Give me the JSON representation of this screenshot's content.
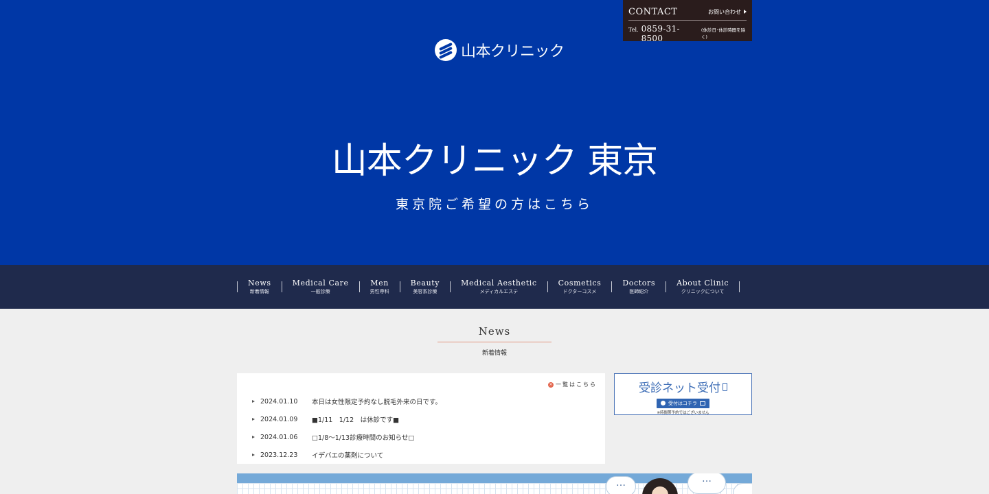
{
  "contact": {
    "title": "CONTACT",
    "inquiry_label": "お問い合わせ",
    "tel_label": "Tel.",
    "tel_number": "0859-31-8500",
    "tel_note": "(休診日･休診時間を除く)"
  },
  "logo": {
    "name": "山本クリニック"
  },
  "hero": {
    "title": "山本クリニック 東京",
    "subtitle": "東京院ご希望の方はこちら"
  },
  "nav": {
    "items": [
      {
        "en": "News",
        "jp": "新着情報"
      },
      {
        "en": "Medical Care",
        "jp": "一般診療"
      },
      {
        "en": "Men",
        "jp": "男性専科"
      },
      {
        "en": "Beauty",
        "jp": "美容系診療"
      },
      {
        "en": "Medical Aesthetic",
        "jp": "メディカルエステ"
      },
      {
        "en": "Cosmetics",
        "jp": "ドクターコスメ"
      },
      {
        "en": "Doctors",
        "jp": "医師紹介"
      },
      {
        "en": "About Clinic",
        "jp": "クリニックについて"
      }
    ]
  },
  "news_section": {
    "heading_en": "News",
    "heading_jp": "新着情報",
    "more_label": "一覧はこちら",
    "items": [
      {
        "date": "2024.01.10",
        "title": "本日は女性限定予約なし脱毛外来の日です。"
      },
      {
        "date": "2024.01.09",
        "title": "■1/11　1/12　は休診です■"
      },
      {
        "date": "2024.01.06",
        "title": "□1/8〜1/13診療時間のお知らせ□"
      },
      {
        "date": "2023.12.23",
        "title": "イデバエの薬剤について"
      }
    ]
  },
  "reception": {
    "title": "受診ネット受付",
    "button_label": "受付はコチラ",
    "note": "※時間帯予約ではございません"
  },
  "banner": {
    "bubble_text": "…"
  }
}
